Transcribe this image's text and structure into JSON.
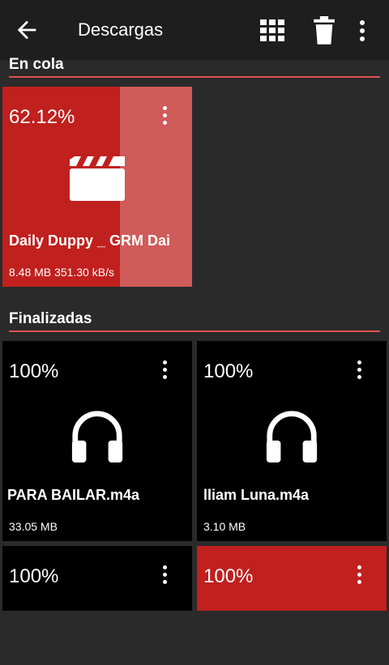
{
  "header": {
    "title": "Descargas",
    "icons": [
      "back-arrow-icon",
      "grid-view-icon",
      "delete-icon",
      "more-vert-icon"
    ]
  },
  "sections": {
    "queued": {
      "title": "En cola"
    },
    "finished": {
      "title": "Finalizadas"
    }
  },
  "queued_item": {
    "percent": "62.12%",
    "progress": 0.6212,
    "filename": "Daily Duppy _ GRM Dai",
    "meta": "8.48 MB 351.30 kB/s",
    "icon": "video-clapper-icon"
  },
  "finished_items": [
    {
      "percent": "100%",
      "filename": "PARA BAILAR.m4a",
      "size": "33.05 MB",
      "icon": "headphones-icon"
    },
    {
      "percent": "100%",
      "filename": "lliam Luna.m4a",
      "size": "3.10 MB",
      "icon": "headphones-icon"
    },
    {
      "percent": "100%"
    },
    {
      "percent": "100%"
    }
  ],
  "colors": {
    "accent": "#c0201e",
    "accent_light": "#cf5b5a",
    "divider": "#e05252",
    "background": "#2a2a2a",
    "appbar": "#1e1e1e"
  }
}
